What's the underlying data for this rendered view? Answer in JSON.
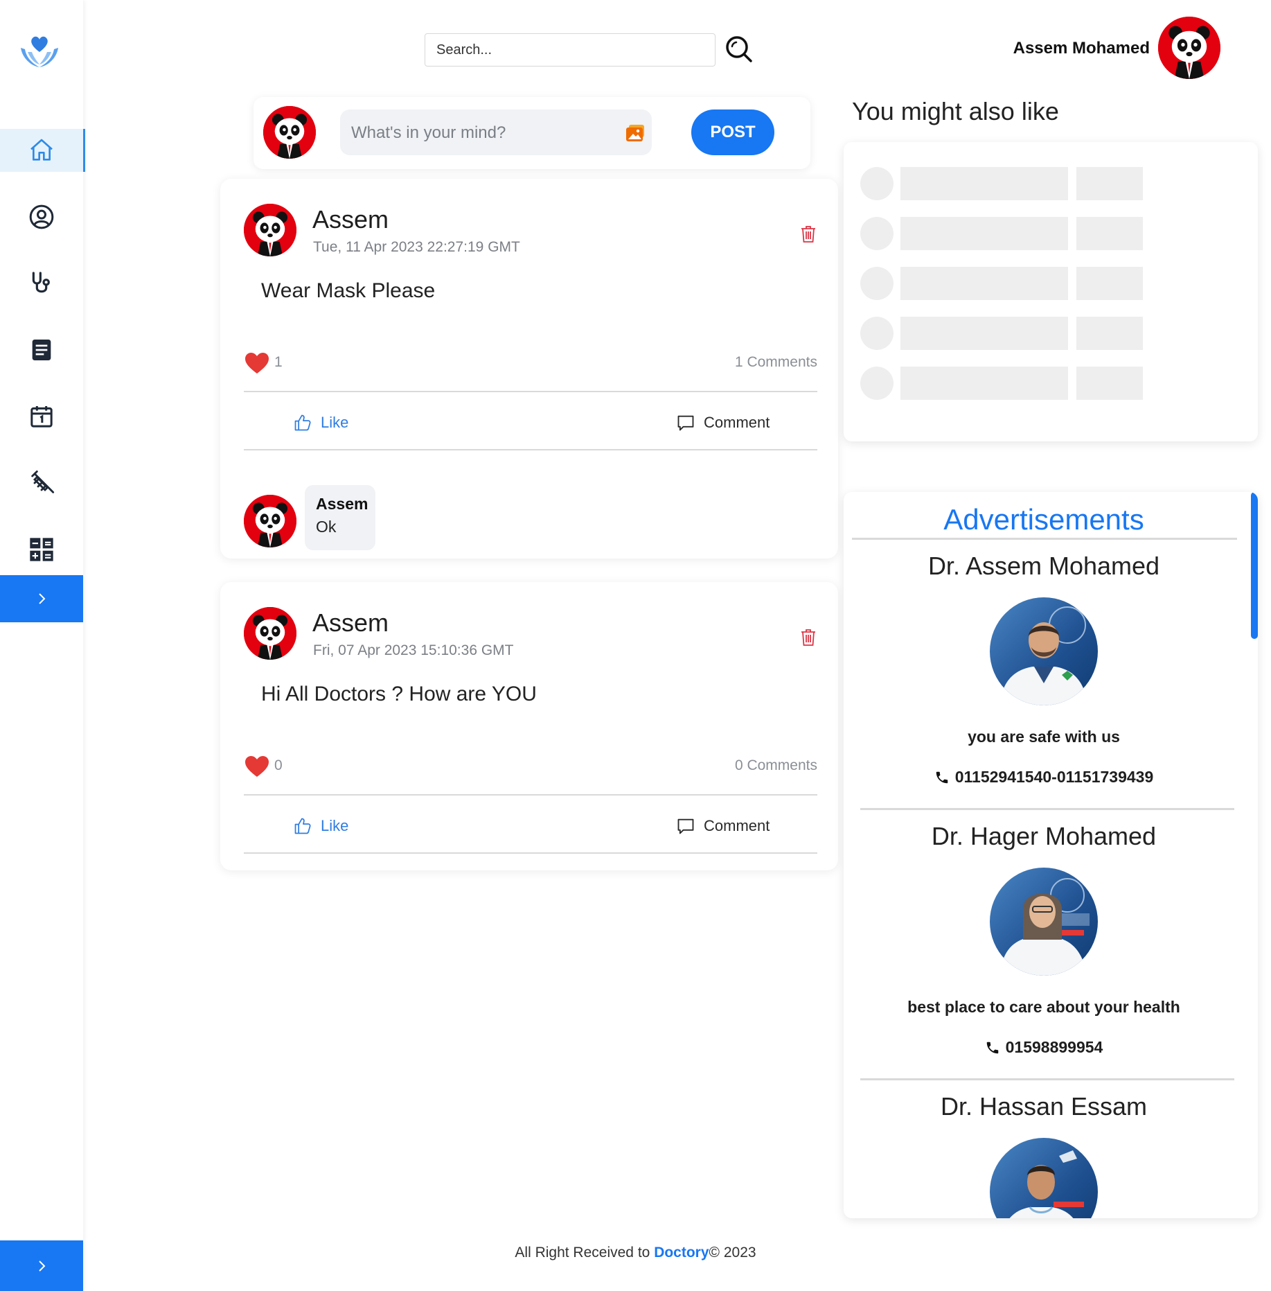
{
  "sidebar": {
    "logo_icon": "heart-hands-logo-icon",
    "items": [
      {
        "icon": "home-icon",
        "active": true
      },
      {
        "icon": "user-circle-icon",
        "active": false
      },
      {
        "icon": "stethoscope-icon",
        "active": false
      },
      {
        "icon": "document-icon",
        "active": false
      },
      {
        "icon": "calendar-icon",
        "active": false
      },
      {
        "icon": "syringe-icon",
        "active": false
      },
      {
        "icon": "calculator-icon",
        "active": false
      }
    ],
    "expand_icon": "chevron-right-icon"
  },
  "header": {
    "search_placeholder": "Search...",
    "user_name": "Assem Mohamed"
  },
  "composer": {
    "placeholder": "What's in your mind?",
    "post_label": "POST"
  },
  "posts": [
    {
      "author": "Assem",
      "date": "Tue, 11 Apr 2023 22:27:19 GMT",
      "body": "Wear Mask Please",
      "likes": "1",
      "comments_count": "1 Comments",
      "like_label": "Like",
      "comment_label": "Comment",
      "comments": [
        {
          "author": "Assem",
          "text": "Ok"
        }
      ]
    },
    {
      "author": "Assem",
      "date": "Fri, 07 Apr 2023 15:10:36 GMT",
      "body": "Hi All Doctors ? How are YOU",
      "likes": "0",
      "comments_count": "0 Comments",
      "like_label": "Like",
      "comment_label": "Comment",
      "comments": []
    }
  ],
  "suggestions": {
    "title": "You might also like"
  },
  "ads": {
    "title": "Advertisements",
    "items": [
      {
        "name": "Dr. Assem Mohamed",
        "slogan": "you are safe with us",
        "phone": "01152941540-01151739439"
      },
      {
        "name": "Dr. Hager Mohamed",
        "slogan": "best place to care about your health",
        "phone": "01598899954"
      },
      {
        "name": "Dr. Hassan Essam"
      }
    ]
  },
  "footer": {
    "prefix": "All Right Received to",
    "brand": "Doctory",
    "suffix": "© 2023"
  },
  "colors": {
    "accent": "#1877f2",
    "sidebar_active_bg": "#e6f2fb",
    "heart": "#e53935",
    "danger": "#dc3545"
  }
}
